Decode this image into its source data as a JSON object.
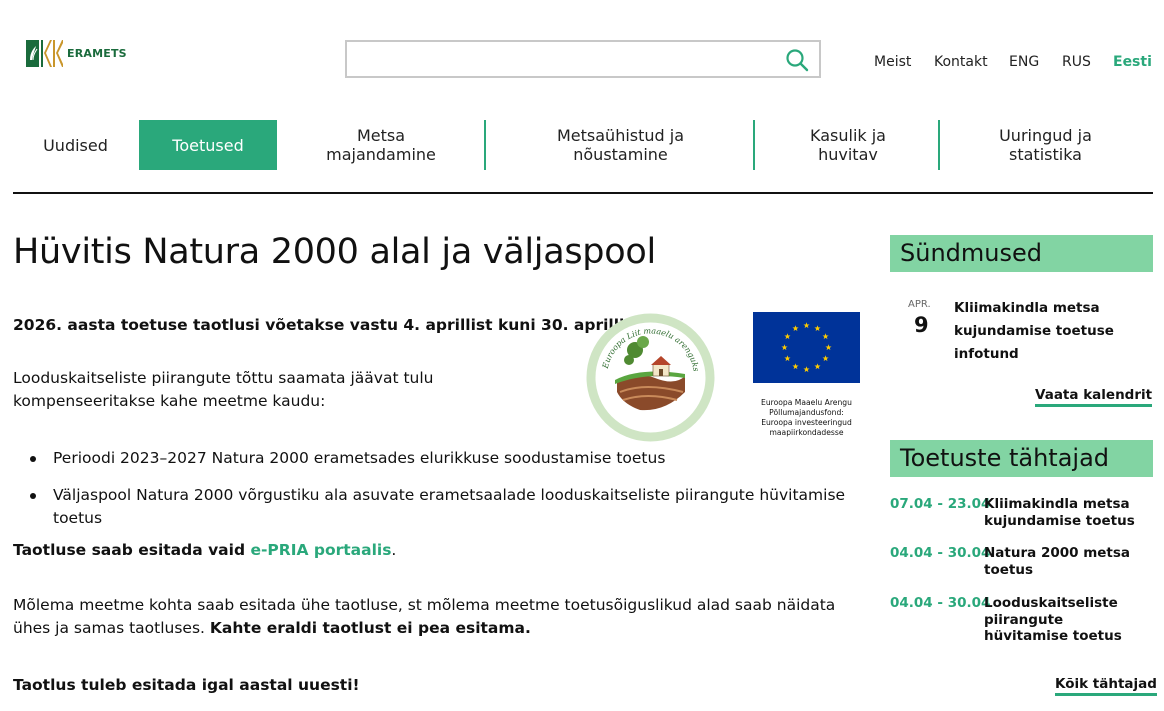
{
  "header": {
    "logo_text": "ERAMETS",
    "search": {
      "value": "",
      "placeholder": ""
    },
    "top_links": [
      "Meist",
      "Kontakt",
      "ENG",
      "RUS",
      "Eesti"
    ],
    "active_language": "Eesti",
    "accent_color": "#2aa87b"
  },
  "nav": {
    "items": [
      {
        "label": "Uudised"
      },
      {
        "label": "Toetused",
        "active": true
      },
      {
        "label": "Metsa\nmajandamine"
      },
      {
        "label": "Metsaühistud ja\nnõustamine"
      },
      {
        "label": "Kasulik ja\nhuvitav"
      },
      {
        "label": "Uuringud ja\nstatistika"
      }
    ]
  },
  "main": {
    "title": "Hüvitis Natura 2000 alal ja väljaspool",
    "intro_bold": "2026. aasta toetuse taotlusi võetakse vastu 4. aprillist kuni 30. aprillini.",
    "para1": "Looduskaitseliste piirangute tõttu saamata jäävat tulu kompenseeritakse kahe meetme kaudu:",
    "bullets": [
      "Perioodi 2023–2027 Natura 2000 erametsades elurikkuse soodustamise toetus",
      "Väljaspool Natura 2000 võrgustiku ala asuvate erametsaalade looduskaitseliste piirangute hüvitamise toetus"
    ],
    "para2_bold": "Taotluse saab esitada vaid ",
    "para2_link": "e-PRIA portaalis",
    "para2_end": ".",
    "para3": "Mõlema meetme kohta saab esitada ühe taotluse, st mõlema meetme toetusõiguslikud alad saab näidata ühes ja samas taotluses. ",
    "para3_bold": "Kahte eraldi taotlust ei pea esitama.",
    "para4_bold": "Taotlus tuleb esitada igal aastal uuesti!",
    "leader_logo_text": "Euroopa Liit maaelu arenguks",
    "eu_caption": "Euroopa Maaelu Arengu Põllumajandusfond: Euroopa investeeringud maapiirkondadesse"
  },
  "sidebar": {
    "events_heading": "Sündmused",
    "event": {
      "month": "APR.",
      "day": "9",
      "title": "Kliimakindla metsa kujundamise toetuse infotund"
    },
    "calendar_link": "Vaata kalendrit",
    "deadlines_heading": "Toetuste tähtajad",
    "deadlines": [
      {
        "dates": "07.04 - 23.04",
        "title": "Kliimakindla metsa kujundamise toetus"
      },
      {
        "dates": "04.04 - 30.04",
        "title": "Natura 2000 metsa toetus"
      },
      {
        "dates": "04.04 - 30.04",
        "title": "Looduskaitseliste piirangute hüvitamise toetus"
      }
    ],
    "all_deadlines_link": "Kõik tähtajad"
  }
}
